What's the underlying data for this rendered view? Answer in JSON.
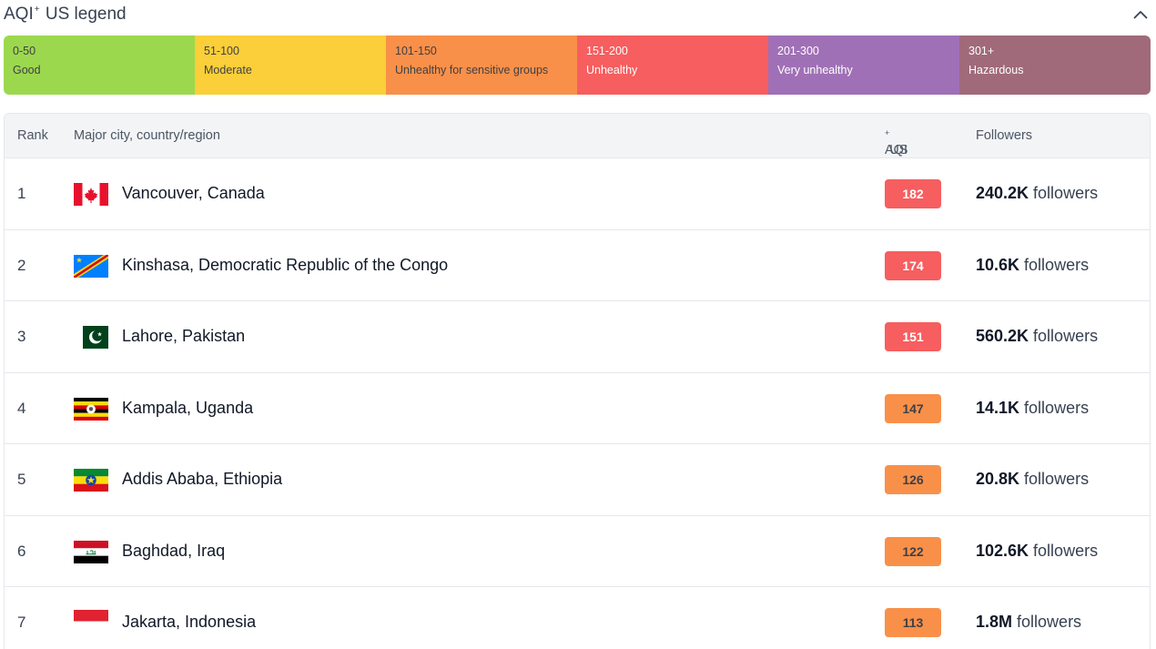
{
  "legend": {
    "title_prefix": "AQI",
    "title_sup": "+",
    "title_suffix": " US legend",
    "collapse_icon": "chevron-up-icon",
    "segments": [
      {
        "range": "0-50",
        "label": "Good",
        "color": "#9cd84e"
      },
      {
        "range": "51-100",
        "label": "Moderate",
        "color": "#facf39"
      },
      {
        "range": "101-150",
        "label": "Unhealthy for sensitive groups",
        "color": "#f99049"
      },
      {
        "range": "151-200",
        "label": "Unhealthy",
        "color": "#f65e5f"
      },
      {
        "range": "201-300",
        "label": "Very unhealthy",
        "color": "#a070b6"
      },
      {
        "range": "301+",
        "label": "Hazardous",
        "color": "#a06a7b"
      }
    ]
  },
  "table": {
    "headers": {
      "rank": "Rank",
      "city": "Major city, country/region",
      "aqi_prefix": "AQI",
      "aqi_sup": "+",
      "aqi_suffix": " US",
      "followers": "Followers"
    },
    "rows": [
      {
        "rank": "1",
        "flag": "canada-flag-icon",
        "city": "Vancouver, Canada",
        "aqi": "182",
        "aqi_color": "#f65e5f",
        "followers_count": "240.2K",
        "followers_suffix": " followers"
      },
      {
        "rank": "2",
        "flag": "dr-congo-flag-icon",
        "city": "Kinshasa, Democratic Republic of the Congo",
        "aqi": "174",
        "aqi_color": "#f65e5f",
        "followers_count": "10.6K",
        "followers_suffix": " followers"
      },
      {
        "rank": "3",
        "flag": "pakistan-flag-icon",
        "city": "Lahore, Pakistan",
        "aqi": "151",
        "aqi_color": "#f65e5f",
        "followers_count": "560.2K",
        "followers_suffix": " followers"
      },
      {
        "rank": "4",
        "flag": "uganda-flag-icon",
        "city": "Kampala, Uganda",
        "aqi": "147",
        "aqi_color": "#f99049",
        "followers_count": "14.1K",
        "followers_suffix": " followers"
      },
      {
        "rank": "5",
        "flag": "ethiopia-flag-icon",
        "city": "Addis Ababa, Ethiopia",
        "aqi": "126",
        "aqi_color": "#f99049",
        "followers_count": "20.8K",
        "followers_suffix": " followers"
      },
      {
        "rank": "6",
        "flag": "iraq-flag-icon",
        "city": "Baghdad, Iraq",
        "aqi": "122",
        "aqi_color": "#f99049",
        "followers_count": "102.6K",
        "followers_suffix": " followers"
      },
      {
        "rank": "7",
        "flag": "indonesia-flag-icon",
        "city": "Jakarta, Indonesia",
        "aqi": "113",
        "aqi_color": "#f99049",
        "followers_count": "1.8M",
        "followers_suffix": " followers"
      }
    ]
  }
}
